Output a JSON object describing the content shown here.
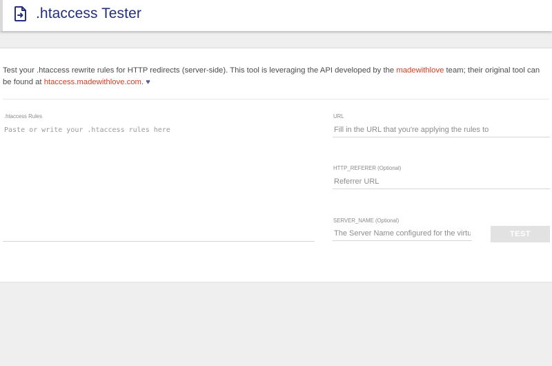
{
  "header": {
    "title": ".htaccess Tester",
    "icon": "file-arrow-icon"
  },
  "intro": {
    "part1": "Test your .htaccess rewrite rules for HTTP redirects (server-side). This tool is leveraging the API developed by the ",
    "link1": "madewithlove",
    "part2": " team; their original tool can be found at ",
    "link2": "htaccess.madewithlove.com",
    "part3": ".",
    "heart": "♥"
  },
  "form": {
    "rules": {
      "label": ".htaccess Rules",
      "placeholder": "Paste or write your .htaccess rules here",
      "value": ""
    },
    "url": {
      "label": "URL",
      "placeholder": "Fill in the URL that you're applying the rules to",
      "value": ""
    },
    "referer": {
      "label": "HTTP_REFERER (Optional)",
      "placeholder": "Referrer URL",
      "value": ""
    },
    "server_name": {
      "label": "SERVER_NAME (Optional)",
      "placeholder": "The Server Name configured for the virtual host",
      "value": ""
    },
    "test_label": "TEST"
  },
  "colors": {
    "title": "#232e7c",
    "link": "#d03f1f",
    "button_disabled": "#e2e2e2"
  }
}
